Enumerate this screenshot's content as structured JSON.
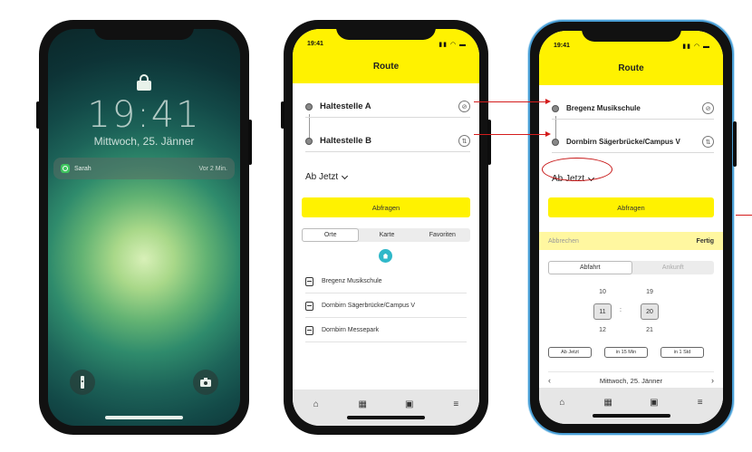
{
  "lockscreen": {
    "time": "19:41",
    "date": "Mittwoch, 25. Jänner",
    "notification": {
      "sender": "Sarah",
      "ago": "Vor 2 Min."
    }
  },
  "app": {
    "status_time": "19:41",
    "title": "Route"
  },
  "screen_a": {
    "stop_a": "Haltestelle A",
    "stop_b": "Haltestelle B",
    "time_selector": "Ab Jetzt",
    "query_button": "Abfragen",
    "tabs": [
      "Orte",
      "Karte",
      "Favoriten"
    ],
    "favorites": [
      "Bregenz Musikschule",
      "Dornbirn Sägerbrücke/Campus V",
      "Dornbirn Messepark"
    ]
  },
  "screen_b": {
    "stop_a": "Bregenz Musikschule",
    "stop_b": "Dornbirn Sägerbrücke/Campus V",
    "time_selector": "Ab Jetzt",
    "query_button": "Abfragen",
    "picker_cancel": "Abbrechen",
    "picker_done": "Fertig",
    "mode_tabs": [
      "Abfahrt",
      "Ankunft"
    ],
    "hours": {
      "prev": "10",
      "current": "11",
      "next": "12"
    },
    "minutes": {
      "prev": "19",
      "current": "20",
      "next": "21"
    },
    "quick_buttons": [
      "Ab Jetzt",
      "in 15 Min",
      "in 1 Std"
    ],
    "date": "Mittwoch, 25. Jänner"
  },
  "icons": {
    "tabbar": [
      "home-icon",
      "map-icon",
      "calendar-icon",
      "menu-icon"
    ]
  },
  "colors": {
    "accent": "#fff200",
    "annotation": "#d41c1c",
    "fab": "#2fb8c9"
  }
}
